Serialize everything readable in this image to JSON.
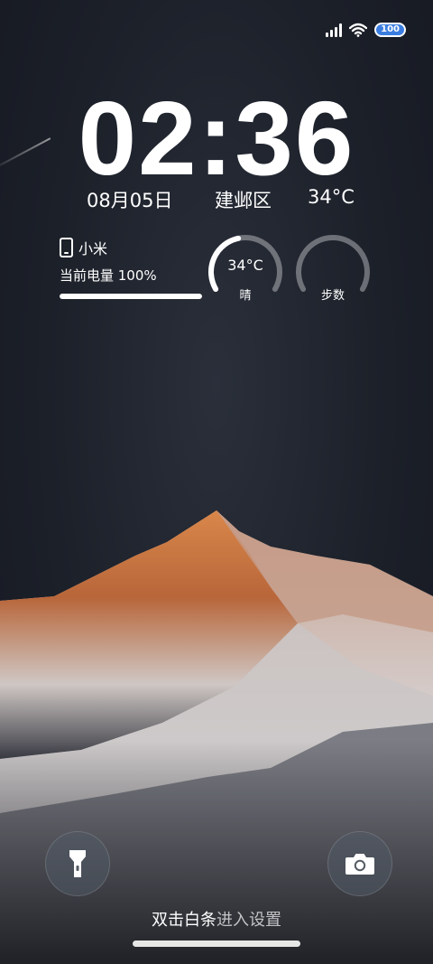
{
  "status_bar": {
    "battery_label": "100",
    "icons": [
      "signal-icon",
      "wifi-icon",
      "battery-icon"
    ]
  },
  "clock": {
    "time": "02:36"
  },
  "info": {
    "date": "08月05日",
    "location": "建邺区",
    "temperature": "34°C"
  },
  "device_widget": {
    "device_name": "小米",
    "battery_text": "当前电量 100%",
    "battery_level": 1.0
  },
  "weather_widget": {
    "temp": "34°C",
    "condition": "晴",
    "level": 0.45
  },
  "steps_widget": {
    "label": "步数",
    "level": 0
  },
  "actions": {
    "flashlight": "flashlight-icon",
    "camera": "camera-icon"
  },
  "hint": {
    "part1": "双击白条",
    "part2": "进入设置"
  }
}
